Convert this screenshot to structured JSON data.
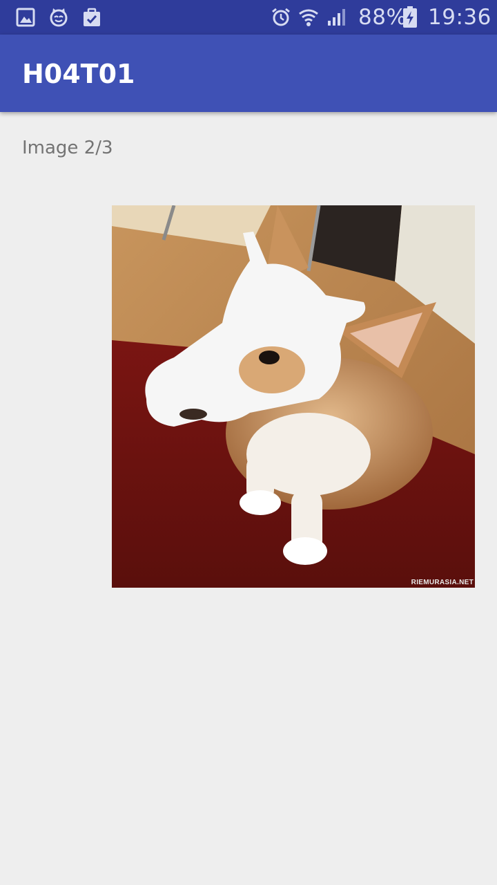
{
  "status_bar": {
    "left_icons": [
      "gallery-icon",
      "cat-face-icon",
      "clipboard-check-icon"
    ],
    "right_icons": [
      "alarm-icon",
      "wifi-icon",
      "cell-signal-icon",
      "battery-charging-icon"
    ],
    "battery_percent": "88%",
    "time": "19:36"
  },
  "app_bar": {
    "title": "H04T01",
    "color": "#3f51b5"
  },
  "content": {
    "image_counter": "Image 2/3",
    "image": {
      "subject": "corgi puppy wearing a white skull mask on a red rug",
      "watermark": "RIEMURASIA.NET"
    }
  },
  "colors": {
    "status_bar": "#2f3c9b",
    "app_bar": "#3f51b5",
    "background": "#eeeeee",
    "counter_text": "#737373"
  }
}
